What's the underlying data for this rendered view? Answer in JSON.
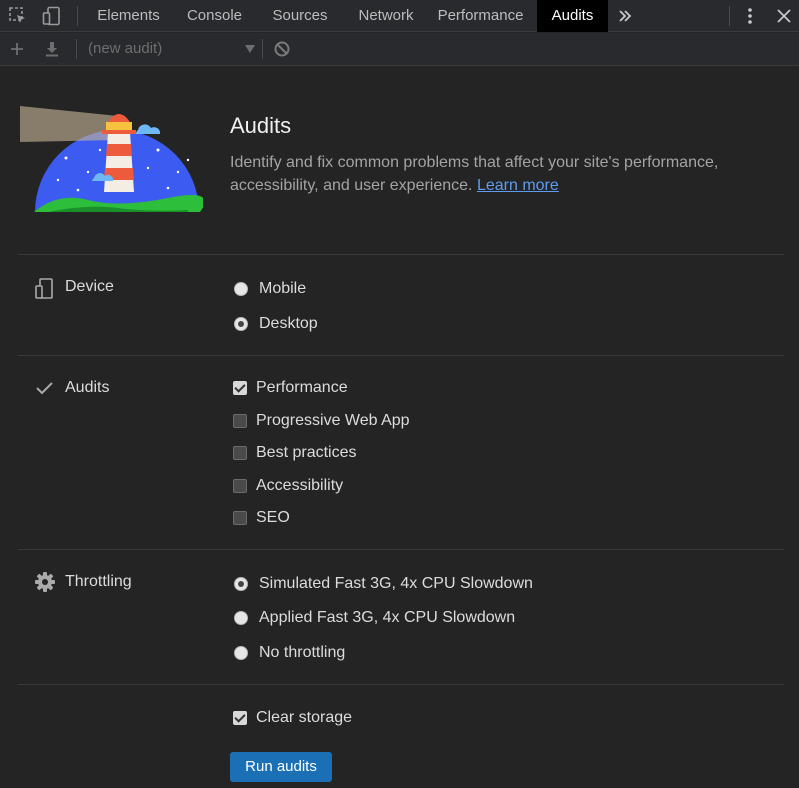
{
  "tabs": [
    {
      "label": "Elements"
    },
    {
      "label": "Console"
    },
    {
      "label": "Sources"
    },
    {
      "label": "Network"
    },
    {
      "label": "Performance"
    },
    {
      "label": "Audits",
      "active": true
    }
  ],
  "toolbar": {
    "audit_select_value": "(new audit)"
  },
  "header": {
    "title": "Audits",
    "description": "Identify and fix common problems that affect your site's performance, accessibility, and user experience.",
    "learn_more": "Learn more"
  },
  "device": {
    "label": "Device",
    "options": [
      {
        "label": "Mobile",
        "checked": false
      },
      {
        "label": "Desktop",
        "checked": true
      }
    ]
  },
  "audits": {
    "label": "Audits",
    "options": [
      {
        "label": "Performance",
        "checked": true
      },
      {
        "label": "Progressive Web App",
        "checked": false
      },
      {
        "label": "Best practices",
        "checked": false
      },
      {
        "label": "Accessibility",
        "checked": false
      },
      {
        "label": "SEO",
        "checked": false
      }
    ]
  },
  "throttling": {
    "label": "Throttling",
    "options": [
      {
        "label": "Simulated Fast 3G, 4x CPU Slowdown",
        "checked": true
      },
      {
        "label": "Applied Fast 3G, 4x CPU Slowdown",
        "checked": false
      },
      {
        "label": "No throttling",
        "checked": false
      }
    ]
  },
  "clear_storage": {
    "label": "Clear storage",
    "checked": true
  },
  "run_button": "Run audits",
  "colors": {
    "accent": "#1a6fb5",
    "link": "#5e9cf0",
    "background": "#242424",
    "active_tab": "#000000"
  },
  "icons": [
    "inspect-element-icon",
    "device-toggle-icon",
    "more-tabs-icon",
    "kebab-menu-icon",
    "close-icon",
    "add-icon",
    "download-icon",
    "dropdown-arrow-icon",
    "clear-icon",
    "lighthouse-logo",
    "device-icon",
    "check-icon",
    "gear-icon"
  ]
}
